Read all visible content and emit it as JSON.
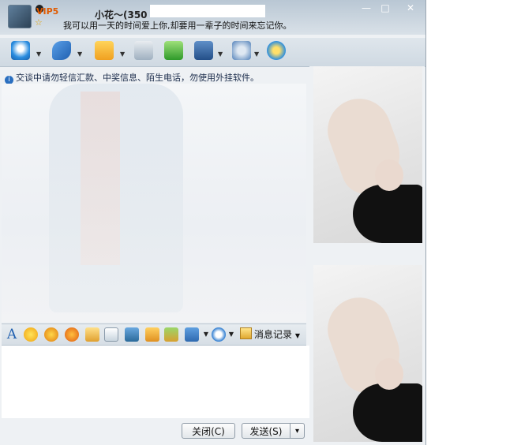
{
  "window": {
    "contact_name": "小花～(350",
    "vip_badge": "VIP5",
    "signature": "我可以用一天的时间爱上你,却要用一辈子的时间来忘记你。",
    "controls": {
      "minimize": "—",
      "maximize": "□",
      "close": "✕"
    }
  },
  "toolbar": {
    "items": [
      {
        "icon": "video-call-icon"
      },
      {
        "icon": "voice-call-icon"
      },
      {
        "icon": "send-file-icon"
      },
      {
        "icon": "send-sms-icon"
      },
      {
        "icon": "add-contact-icon"
      },
      {
        "icon": "remote-assist-icon"
      },
      {
        "icon": "apps-icon"
      },
      {
        "icon": "qzone-icon"
      }
    ]
  },
  "notice": {
    "text": "交谈中请勿轻信汇款、中奖信息、陌生电话，勿使用外挂软件。"
  },
  "format_bar": {
    "font_glyph": "A",
    "history_label": "消息记录"
  },
  "input": {
    "value": ""
  },
  "buttons": {
    "close_label": "关闭(C)",
    "send_label": "发送(S)",
    "send_menu": "▾"
  },
  "colors": {
    "title_gradient_top": "#b9c7d4",
    "toolbar_bg": "#d6dee5",
    "vip_color": "#e05a00"
  }
}
